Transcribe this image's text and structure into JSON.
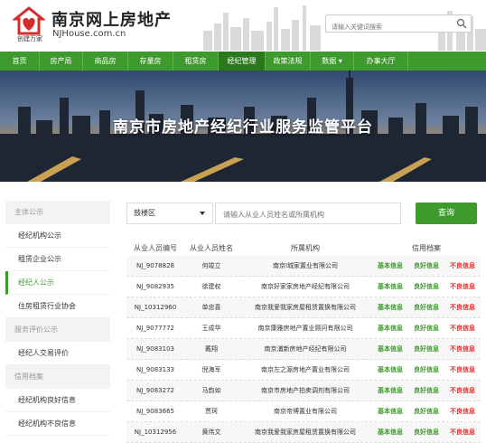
{
  "header": {
    "logo_sub": "创建万家",
    "title": "南京网上房地产",
    "domain": "NJHouse.com.cn",
    "search_placeholder": "请输入关键词搜索"
  },
  "nav": {
    "items": [
      {
        "label": "首页",
        "width": 44
      },
      {
        "label": "房产局",
        "width": 48
      },
      {
        "label": "商品房",
        "width": 50
      },
      {
        "label": "存量房",
        "width": 50
      },
      {
        "label": "租赁房",
        "width": 50
      },
      {
        "label": "经纪管理",
        "width": 52,
        "active": true
      },
      {
        "label": "政策法规",
        "width": 50
      },
      {
        "label": "数据 ▾",
        "width": 48
      },
      {
        "label": "办事大厅",
        "width": 60
      }
    ]
  },
  "banner": {
    "title": "南京市房地产经纪行业服务监管平台"
  },
  "sidebar": {
    "groups": [
      {
        "head": "主体公示",
        "items": [
          {
            "label": "经纪机构公示"
          },
          {
            "label": "租赁企业公示"
          },
          {
            "label": "经纪人公示",
            "active": true
          },
          {
            "label": "住房租赁行业协会"
          }
        ]
      },
      {
        "head": "服务评价公示",
        "items": [
          {
            "label": "经纪人交易评价"
          }
        ]
      },
      {
        "head": "信用档案",
        "items": [
          {
            "label": "经纪机构良好信息"
          },
          {
            "label": "经纪机构不良信息"
          }
        ]
      }
    ]
  },
  "filter": {
    "district": "鼓楼区",
    "input_placeholder": "请输入从业人员姓名或所属机构",
    "query_label": "查询"
  },
  "table": {
    "headers": [
      "从业人员编号",
      "从业人员姓名",
      "所属机构",
      "信用档案"
    ],
    "link_labels": [
      "基本信息",
      "良好信息",
      "不良信息"
    ],
    "rows": [
      [
        "NJ_9078828",
        "何竣立",
        "南京I城家置业有限公司"
      ],
      [
        "NJ_9082935",
        "徐建权",
        "南京好家家房地产经纪有限公司"
      ],
      [
        "NJ_10312960",
        "单忠喜",
        "南京我爱我家房屋租赁置换有限公司"
      ],
      [
        "NJ_9077772",
        "王成华",
        "南京康雅房地产置业顾问有限公司"
      ],
      [
        "NJ_9083103",
        "戴翔",
        "南京浦新房地产经纪有限公司"
      ],
      [
        "NJ_9083133",
        "倪海军",
        "南京左之源房地产置业有限公司"
      ],
      [
        "NJ_9083272",
        "马韵如",
        "南京市房地产拍卖调剂有限公司"
      ],
      [
        "NJ_9083665",
        "贾珂",
        "南京帝博置业有限公司"
      ],
      [
        "NJ_10312956",
        "黄伟文",
        "南京我爱我家房屋租赁置换有限公司"
      ]
    ]
  }
}
